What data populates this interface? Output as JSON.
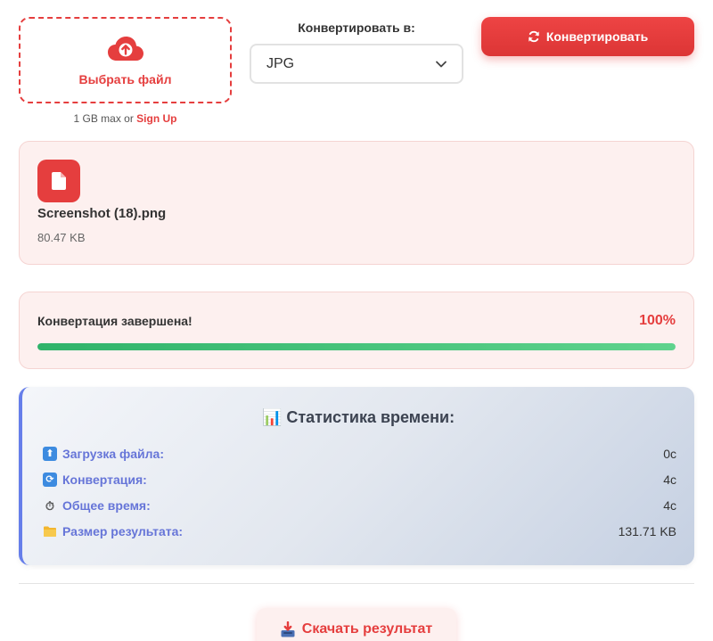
{
  "upload": {
    "button_label": "Выбрать файл",
    "limit_text": "1 GB max or ",
    "signup_label": "Sign Up",
    "icon": "cloud-upload-icon"
  },
  "convert": {
    "label": "Конвертировать в:",
    "selected_format": "JPG",
    "button_label": "Конвертировать",
    "button_icon": "refresh-icon"
  },
  "file": {
    "name": "Screenshot (18).png",
    "size": "80.47 KB",
    "icon": "file-icon"
  },
  "progress": {
    "status": "Конвертация завершена!",
    "percent_label": "100%",
    "percent": 100
  },
  "stats": {
    "title": "📊 Статистика времени:",
    "rows": [
      {
        "icon": "upload-arrow-icon",
        "label": "Загрузка файла:",
        "value": "0с"
      },
      {
        "icon": "convert-icon",
        "label": "Конвертация:",
        "value": "4с"
      },
      {
        "icon": "stopwatch-icon",
        "label": "Общее время:",
        "value": "4с"
      },
      {
        "icon": "folder-icon",
        "label": "Размер результата:",
        "value": "131.71 KB"
      }
    ]
  },
  "download": {
    "label": "Скачать результат",
    "icon": "download-tray-icon"
  },
  "colors": {
    "accent": "#e53e3e",
    "progress_green": "#3cc27a",
    "stats_label": "#6675d8",
    "stats_border": "#667eea"
  }
}
